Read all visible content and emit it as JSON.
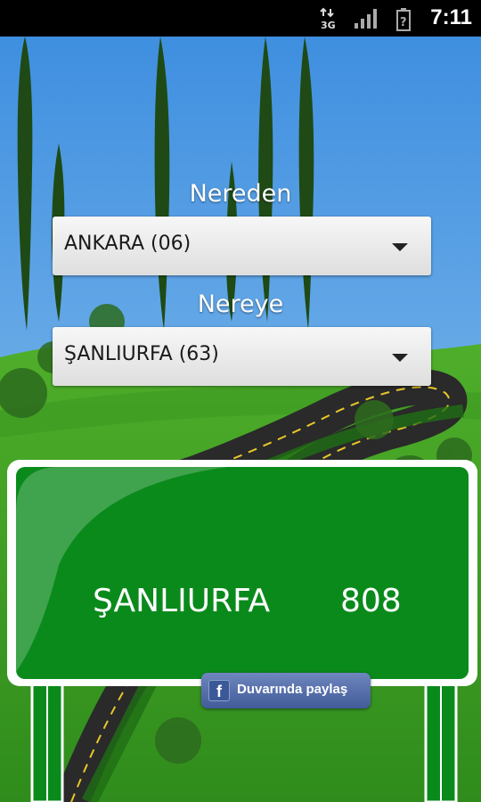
{
  "status_bar": {
    "time": "7:11",
    "network_label_top": "3G",
    "icons": [
      "data-transfer-icon",
      "signal-icon",
      "battery-icon"
    ]
  },
  "from": {
    "label": "Nereden",
    "selected": "ANKARA (06)"
  },
  "to": {
    "label": "Nereye",
    "selected": "ŞANLIURFA (63)"
  },
  "result_sign": {
    "city": "ŞANLIURFA",
    "distance": "808",
    "color": "#0b8a1c"
  },
  "share_button": {
    "label": "Duvarında paylaş",
    "icon": "facebook-icon"
  }
}
